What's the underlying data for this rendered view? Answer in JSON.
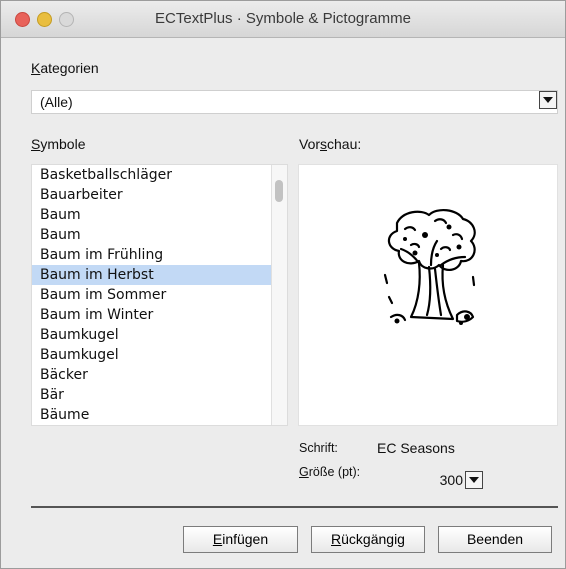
{
  "window": {
    "title": "ECTextPlus · Symbole & Pictogramme"
  },
  "categories": {
    "label_key": "K",
    "label_rest": "ategorien",
    "selected": "(Alle)"
  },
  "symbols": {
    "label_key": "S",
    "label_rest": "ymbole",
    "items": [
      "Basketballschläger",
      "Bauarbeiter",
      "Baum",
      "Baum",
      "Baum im Frühling",
      "Baum im Herbst",
      "Baum im Sommer",
      "Baum im Winter",
      "Baumkugel",
      "Baumkugel",
      "Bäcker",
      "Bär",
      "Bäume"
    ],
    "selected_index": 5
  },
  "preview": {
    "label_pre": "Vor",
    "label_key": "s",
    "label_post": "chau:"
  },
  "font": {
    "label": "Schrift:",
    "value": "EC Seasons"
  },
  "size": {
    "label_key": "G",
    "label_rest": "röße (pt):",
    "value": "300"
  },
  "buttons": {
    "insert": {
      "key": "E",
      "rest": "infügen"
    },
    "undo": {
      "key": "R",
      "rest": "ückgängig"
    },
    "quit": {
      "label": "Beenden"
    }
  }
}
